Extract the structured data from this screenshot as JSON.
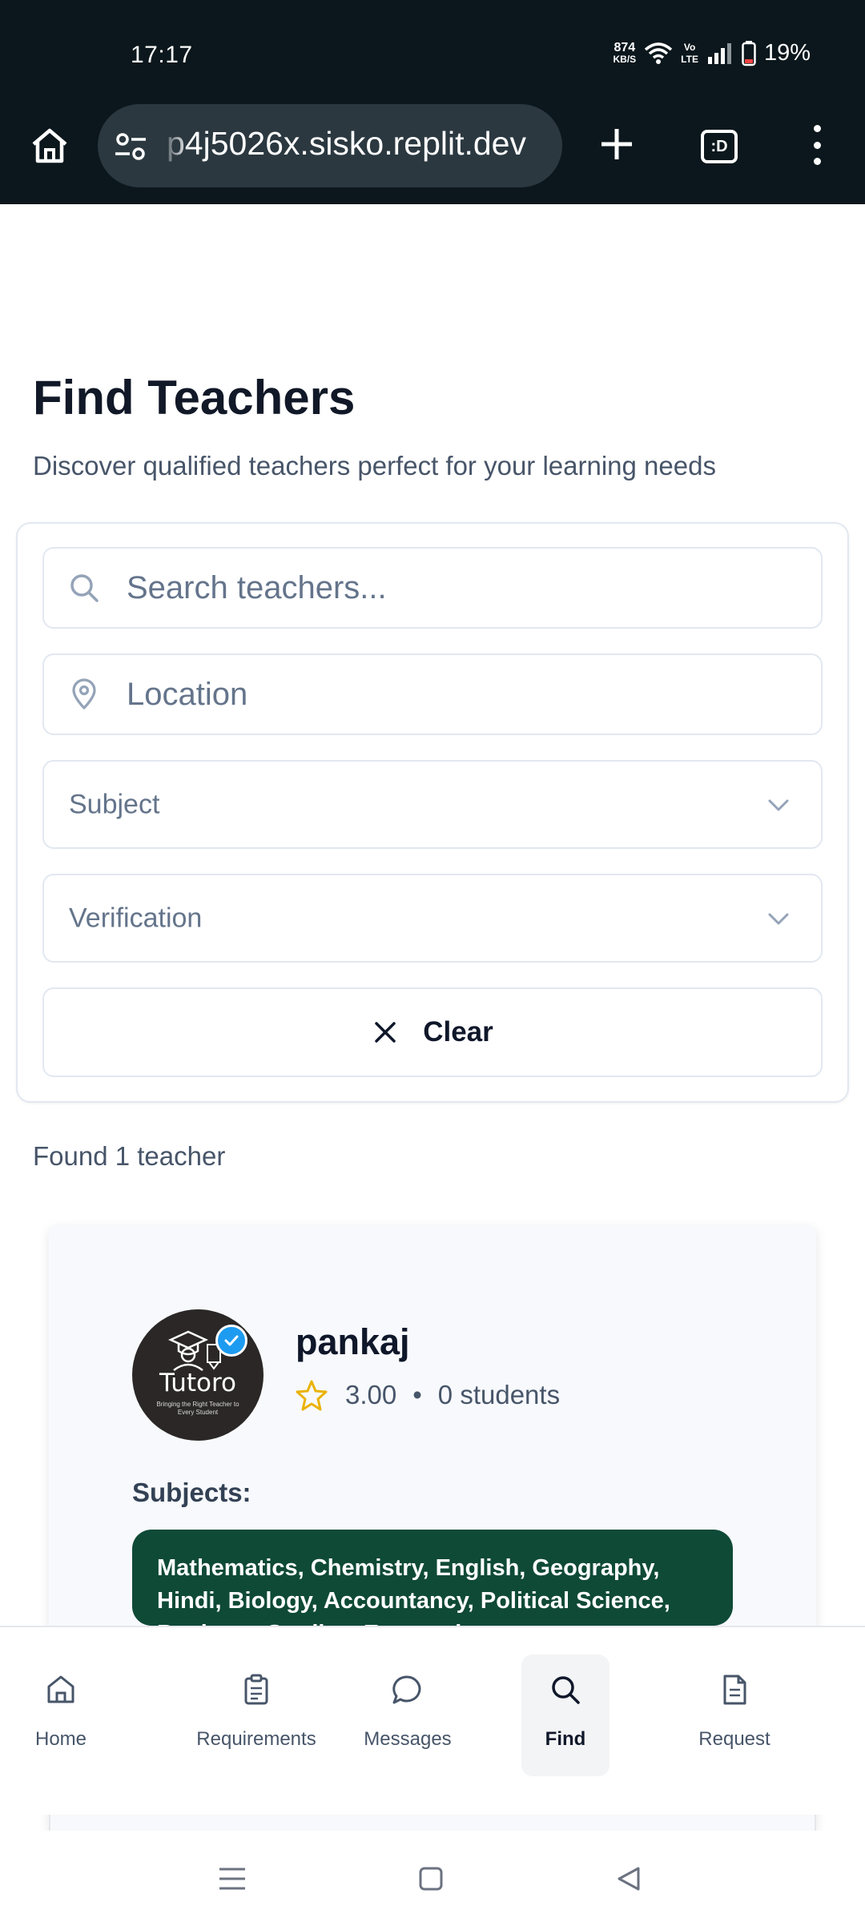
{
  "status_bar": {
    "time": "17:17",
    "net_speed_value": "874",
    "net_speed_unit": "KB/S",
    "volte_top": "Vo",
    "volte_bottom": "LTE",
    "battery": "19%"
  },
  "browser": {
    "url": "p4j5026x.sisko.replit.dev",
    "tab_label": ":D",
    "icons": [
      "home-icon",
      "site-settings-icon",
      "plus-icon",
      "tab-switcher-icon",
      "more-vert-icon"
    ]
  },
  "page": {
    "title": "Find Teachers",
    "subtitle": "Discover qualified teachers perfect for your learning needs"
  },
  "filters": {
    "search_placeholder": "Search teachers...",
    "location_placeholder": "Location",
    "subject_placeholder": "Subject",
    "verification_placeholder": "Verification",
    "clear_label": "Clear"
  },
  "results": {
    "found_text": "Found 1 teacher"
  },
  "teacher": {
    "name": "pankaj",
    "rating": "3.00",
    "separator": "•",
    "students": "0 students",
    "avatar_brand": "Tutoro",
    "avatar_tagline": "Bringing the Right Teacher to Every Student",
    "subjects_label": "Subjects:",
    "subjects": "Mathematics, Chemistry, English, Geography, Hindi, Biology, Accountancy, Political Science, Business Studies, Economics"
  },
  "bottom_nav": {
    "items": [
      {
        "label": "Home",
        "icon": "home-icon"
      },
      {
        "label": "Requirements",
        "icon": "clipboard-icon"
      },
      {
        "label": "Messages",
        "icon": "chat-icon"
      },
      {
        "label": "Find",
        "icon": "search-icon",
        "active": true
      },
      {
        "label": "Request",
        "icon": "document-icon"
      }
    ]
  },
  "colors": {
    "chrome_bg": "#0b171c",
    "url_bar_bg": "#2b3840",
    "subject_pill_bg": "#0f4a37",
    "star": "#eab308",
    "verified_badge": "#1d9bf0"
  }
}
